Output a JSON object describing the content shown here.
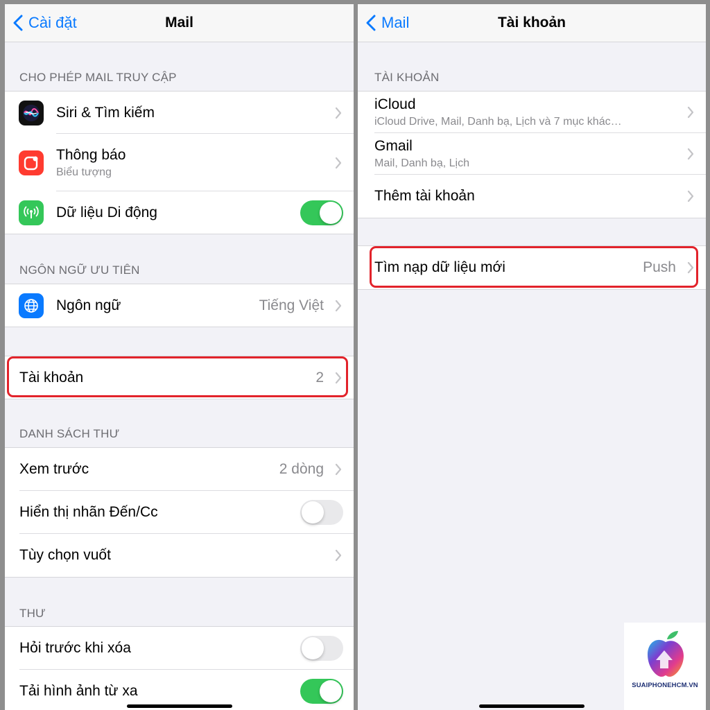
{
  "left": {
    "nav": {
      "back_label": "Cài đặt",
      "title": "Mail"
    },
    "sections": {
      "allow_access": "CHO PHÉP MAIL TRUY CẬP",
      "preferred_language": "NGÔN NGỮ ƯU TIÊN",
      "message_list": "DANH SÁCH THƯ",
      "messages": "THƯ"
    },
    "rows": {
      "siri": {
        "label": "Siri & Tìm kiếm"
      },
      "notifications": {
        "label": "Thông báo",
        "sub": "Biểu tượng"
      },
      "cellular": {
        "label": "Dữ liệu Di động",
        "enabled": true
      },
      "language": {
        "label": "Ngôn ngữ",
        "value": "Tiếng Việt"
      },
      "accounts": {
        "label": "Tài khoản",
        "value": "2"
      },
      "preview": {
        "label": "Xem trước",
        "value": "2 dòng"
      },
      "show_to_cc": {
        "label": "Hiển thị nhãn Đến/Cc",
        "enabled": false
      },
      "swipe_options": {
        "label": "Tùy chọn vuốt"
      },
      "ask_before_delete": {
        "label": "Hỏi trước khi xóa",
        "enabled": false
      },
      "load_remote_images": {
        "label": "Tải hình ảnh từ xa",
        "enabled": true
      }
    }
  },
  "right": {
    "nav": {
      "back_label": "Mail",
      "title": "Tài khoản"
    },
    "sections": {
      "accounts": "TÀI KHOẢN"
    },
    "rows": {
      "icloud": {
        "label": "iCloud",
        "sub": "iCloud Drive, Mail, Danh bạ, Lịch và 7 mục khác…"
      },
      "gmail": {
        "label": "Gmail",
        "sub": "Mail, Danh bạ, Lịch"
      },
      "add_account": {
        "label": "Thêm tài khoản"
      },
      "fetch_new_data": {
        "label": "Tìm nạp dữ liệu mới",
        "value": "Push"
      }
    }
  },
  "watermark": {
    "text": "SUAIPHONEHCM.VN"
  },
  "colors": {
    "accent": "#0a7aff",
    "toggle_on": "#34c759",
    "highlight": "#e2232b"
  }
}
